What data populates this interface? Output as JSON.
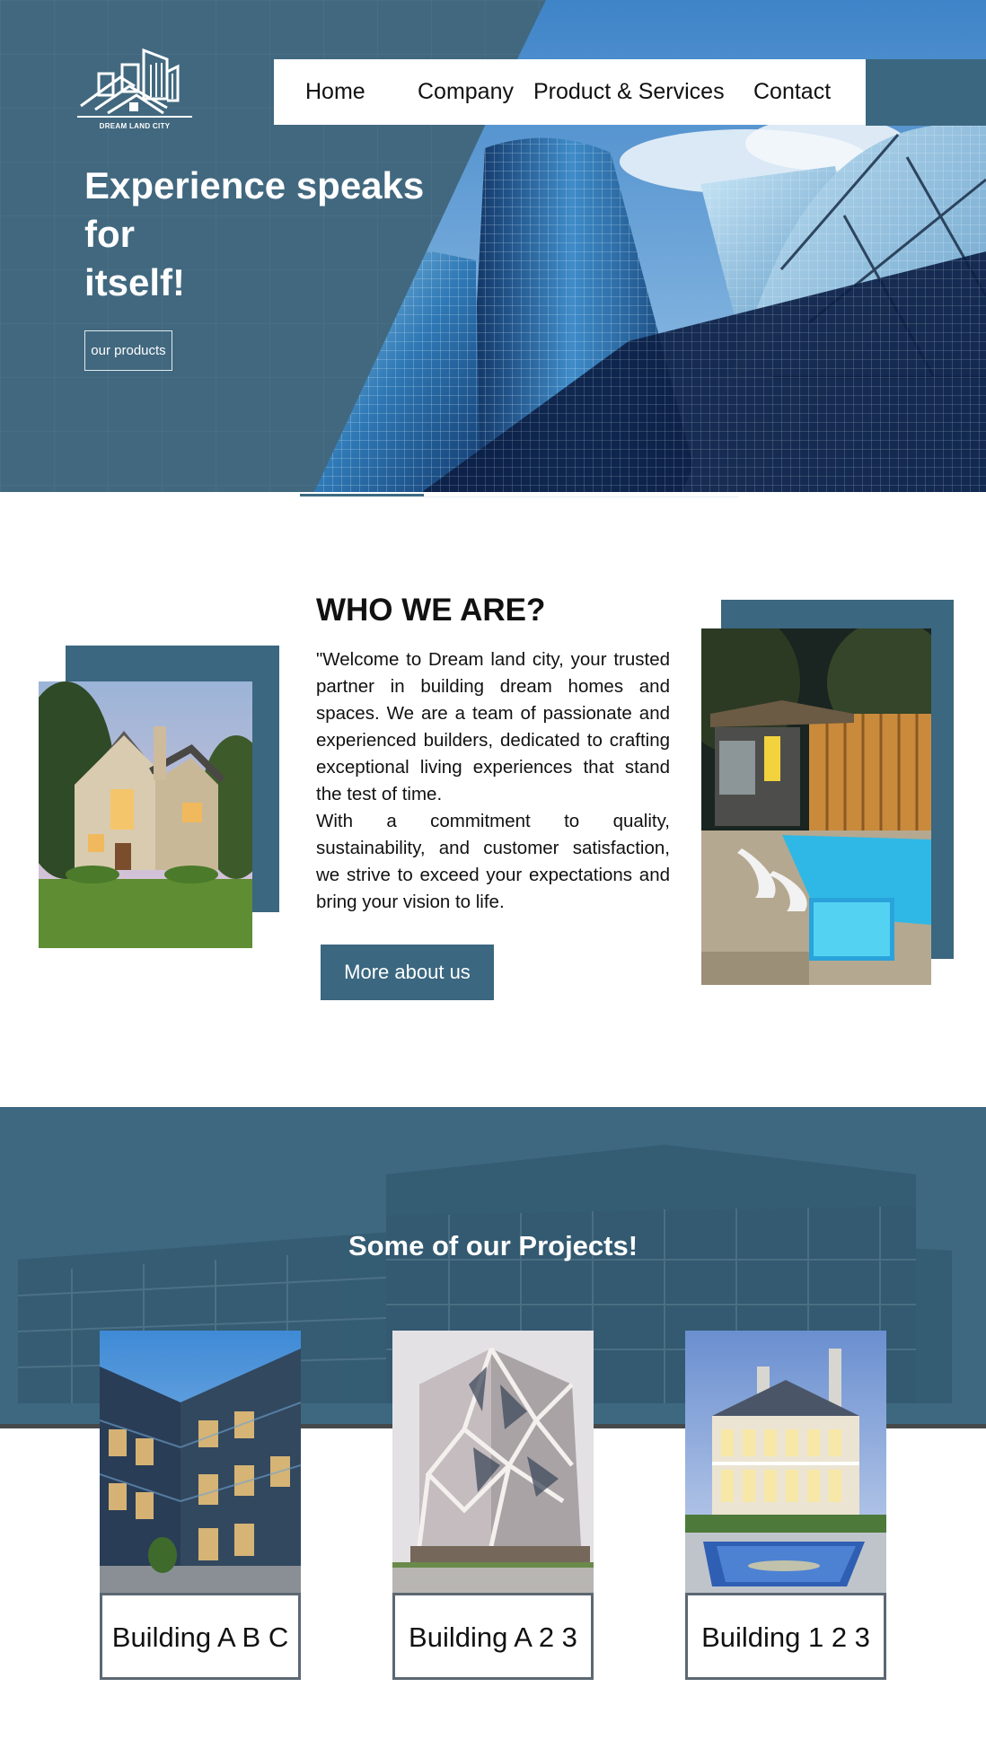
{
  "brand": {
    "name": "DREAM LAND CITY",
    "logo_icon": "building-house-logo-icon"
  },
  "nav": {
    "items": [
      {
        "label": "Home"
      },
      {
        "label": "Company"
      },
      {
        "label": "Product & Services"
      },
      {
        "label": "Contact"
      }
    ]
  },
  "hero": {
    "title_part1": "Experience ",
    "title_bold1": "speaks",
    "title_part2": " for",
    "title_bold2": "itself!",
    "button_label": "our products"
  },
  "about": {
    "heading_light": "WHO ",
    "heading_bold": "WE ARE?",
    "paragraph1": "\"Welcome to Dream land city, your trusted partner in building dream homes and spaces. We are a team of passionate and experienced builders, dedicated to crafting exceptional living experiences that stand the test of time.",
    "paragraph2": "With a commitment to quality, sustainability, and customer satisfaction, we strive to exceed your expectations and bring your vision to life.",
    "button_label": "More about us"
  },
  "projects": {
    "title": "Some of our Projects!",
    "items": [
      {
        "label": "Building A B C"
      },
      {
        "label": "Building A 2 3"
      },
      {
        "label": "Building 1 2 3"
      }
    ]
  },
  "colors": {
    "brand_blue": "#3b6780",
    "white": "#ffffff",
    "card_border": "#5c6872"
  }
}
